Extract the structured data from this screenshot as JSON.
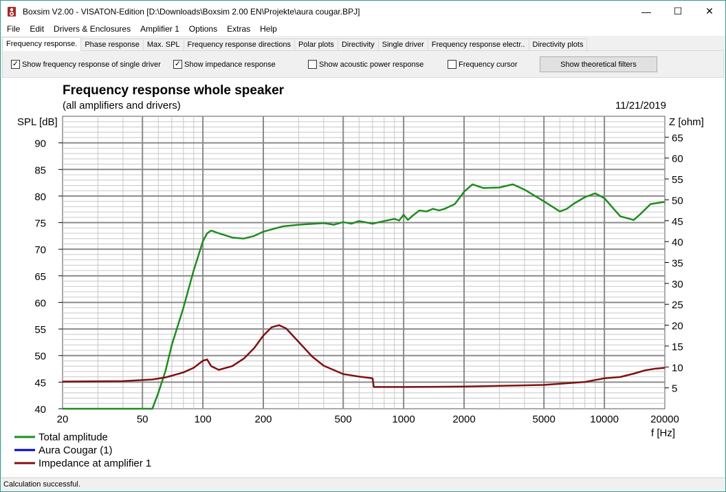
{
  "window": {
    "title": "Boxsim V2.00 - VISATON-Edition [D:\\Downloads\\Boxsim 2.00 EN\\Projekte\\aura cougar.BPJ]",
    "minimize": "—",
    "maximize": "☐",
    "close": "✕"
  },
  "menu": [
    "File",
    "Edit",
    "Drivers & Enclosures",
    "Amplifier 1",
    "Options",
    "Extras",
    "Help"
  ],
  "tabs": [
    "Frequency response.",
    "Phase response",
    "Max. SPL",
    "Frequency response directions",
    "Polar plots",
    "Directivity",
    "Single driver",
    "Frequency response electr..",
    "Directivity plots"
  ],
  "active_tab": 0,
  "options": {
    "single_driver": {
      "label": "Show frequency response of single driver",
      "checked": true
    },
    "impedance": {
      "label": "Show impedance response",
      "checked": true
    },
    "acoustic_power": {
      "label": "Show acoustic power response",
      "checked": false
    },
    "cursor": {
      "label": "Frequency cursor",
      "checked": false
    },
    "filters_button": "Show theoretical filters"
  },
  "chart_data": {
    "type": "line",
    "title": "Frequency response whole speaker",
    "subtitle": "(all amplifiers and drivers)",
    "date": "11/21/2019",
    "ylabel": "SPL [dB]",
    "y2label": "Z [ohm]",
    "xlabel": "f [Hz]",
    "x_scale": "log",
    "xlim": [
      20,
      20000
    ],
    "ylim": [
      40,
      95
    ],
    "y2lim": [
      0,
      70
    ],
    "x_ticks": [
      20,
      50,
      100,
      200,
      500,
      1000,
      2000,
      5000,
      10000,
      20000
    ],
    "y_ticks": [
      40,
      45,
      50,
      55,
      60,
      65,
      70,
      75,
      80,
      85,
      90
    ],
    "y2_ticks": [
      5,
      10,
      15,
      20,
      25,
      30,
      35,
      40,
      45,
      50,
      55,
      60,
      65
    ],
    "grid": true,
    "legend_position": "bottom-left",
    "series": [
      {
        "name": "Total amplitude",
        "color": "#1e8c1e",
        "axis": "left",
        "x": [
          20,
          56,
          60,
          65,
          70,
          80,
          90,
          100,
          105,
          110,
          120,
          140,
          160,
          180,
          200,
          250,
          300,
          400,
          450,
          500,
          550,
          600,
          700,
          800,
          900,
          950,
          1000,
          1050,
          1100,
          1200,
          1300,
          1400,
          1500,
          1600,
          1800,
          2000,
          2200,
          2500,
          3000,
          3500,
          4000,
          5000,
          6000,
          6500,
          7000,
          8000,
          9000,
          10000,
          11000,
          12000,
          14000,
          15000,
          17000,
          20000
        ],
        "y": [
          40,
          40,
          43,
          47,
          52,
          59,
          66,
          71.5,
          73,
          73.5,
          73,
          72.2,
          72,
          72.5,
          73.3,
          74.3,
          74.6,
          74.9,
          74.6,
          75.1,
          74.8,
          75.3,
          74.8,
          75.3,
          75.7,
          75.4,
          76.5,
          75.5,
          76.2,
          77.3,
          77.1,
          77.6,
          77.3,
          77.6,
          78.5,
          80.8,
          82.2,
          81.5,
          81.6,
          82.2,
          81.2,
          79,
          77.1,
          77.6,
          78.5,
          79.8,
          80.5,
          79.6,
          77.8,
          76.2,
          75.5,
          76.5,
          78.5,
          78.9
        ]
      },
      {
        "name": "Aura Cougar (1)",
        "color": "#0000cc",
        "axis": "left",
        "x": [],
        "y": []
      },
      {
        "name": "Impedance at amplifier 1",
        "color": "#7f1010",
        "axis": "right",
        "x": [
          20,
          40,
          56,
          65,
          70,
          80,
          90,
          100,
          105,
          110,
          120,
          140,
          160,
          180,
          200,
          220,
          240,
          260,
          300,
          350,
          400,
          500,
          600,
          700,
          710,
          1000,
          2000,
          5000,
          8000,
          10000,
          12000,
          14000,
          16000,
          18000,
          20000
        ],
        "y": [
          6.5,
          6.6,
          7,
          7.5,
          7.9,
          8.7,
          9.8,
          11.5,
          11.8,
          10.2,
          9.3,
          10.2,
          12,
          14.5,
          17.5,
          19.5,
          20,
          19.2,
          16,
          12.5,
          10.3,
          8.3,
          7.7,
          7.3,
          5.2,
          5.2,
          5.3,
          5.7,
          6.4,
          7.3,
          7.6,
          8.4,
          9.2,
          9.6,
          9.8
        ]
      }
    ]
  },
  "status": "Calculation successful."
}
